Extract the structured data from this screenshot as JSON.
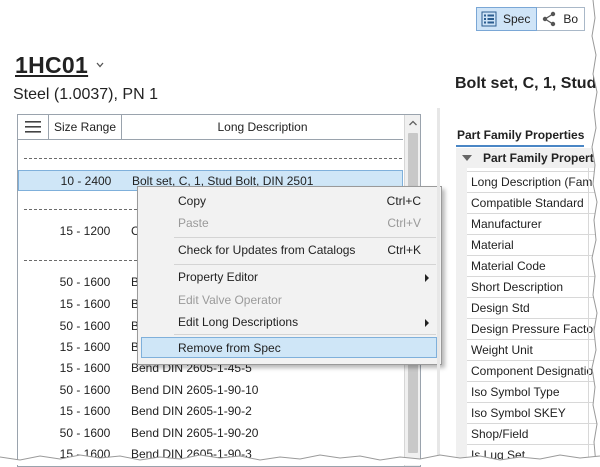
{
  "toolbar": {
    "spec_label": "Spec",
    "second_label": "Bo"
  },
  "spec": {
    "title": "1HC01",
    "subtitle": "Steel (1.0037), PN 1"
  },
  "grid": {
    "columns": {
      "size": "Size Range",
      "desc": "Long Description"
    },
    "rows": [
      {
        "size": "10 - 2400",
        "desc": "Bolt set, C, 1, Stud Bolt, DIN 2501"
      },
      {
        "size": "15 - 1200",
        "desc": "C"
      },
      {
        "size": "50 - 1600",
        "desc": "Bend"
      },
      {
        "size": "15 - 1600",
        "desc": "Bend"
      },
      {
        "size": "50 - 1600",
        "desc": "Bend"
      },
      {
        "size": "15 - 1600",
        "desc": "Bend"
      },
      {
        "size": "15 - 1600",
        "desc": "Bend DIN 2605-1-45-5"
      },
      {
        "size": "50 - 1600",
        "desc": "Bend DIN 2605-1-90-10"
      },
      {
        "size": "15 - 1600",
        "desc": "Bend DIN 2605-1-90-2"
      },
      {
        "size": "50 - 1600",
        "desc": "Bend DIN 2605-1-90-20"
      },
      {
        "size": "15 - 1600",
        "desc": "Bend DIN 2605-1-90-3"
      }
    ]
  },
  "context_menu": {
    "items": [
      {
        "label": "Copy",
        "shortcut": "Ctrl+C"
      },
      {
        "label": "Paste",
        "shortcut": "Ctrl+V"
      },
      {
        "label": "Check for Updates from Catalogs",
        "shortcut": "Ctrl+K"
      },
      {
        "label": "Property Editor"
      },
      {
        "label": "Edit Valve Operator"
      },
      {
        "label": "Edit Long Descriptions"
      },
      {
        "label": "Remove from Spec"
      }
    ]
  },
  "detail": {
    "title": "Bolt set, C, 1, Stud",
    "props_header": "Part Family Properties",
    "group_label": "Part Family Properti",
    "properties": [
      "Long Description (Famil",
      "Compatible Standard",
      "Manufacturer",
      "Material",
      "Material Code",
      "Short Description",
      "Design Std",
      "Design Pressure Factor",
      "Weight Unit",
      "Component Designatio",
      "Iso Symbol Type",
      "Iso Symbol SKEY",
      "Shop/Field",
      "Is Lug Set"
    ]
  }
}
